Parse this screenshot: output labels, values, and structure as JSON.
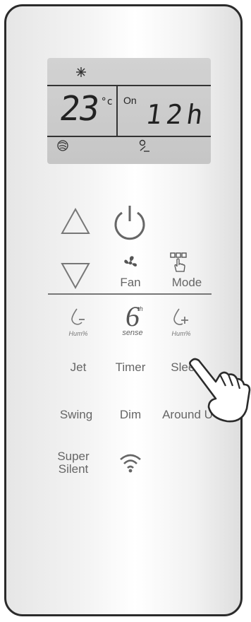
{
  "display": {
    "temperature": "23",
    "unit": "°c",
    "on_label": "On",
    "timer_value": "12h"
  },
  "buttons": {
    "fan": "Fan",
    "mode": "Mode",
    "hum_minus_sub": "Hum%",
    "sense_sub": "sense",
    "sense_sup": "th",
    "hum_plus_sub": "Hum%",
    "jet": "Jet",
    "timer": "Timer",
    "sleep": "Sleep",
    "swing": "Swing",
    "dim": "Dim",
    "around_u": "Around U",
    "super_silent_line1": "Super",
    "super_silent_line2": "Silent"
  },
  "icons": [
    "snowflake-icon",
    "fan-speed-icon",
    "person-icon",
    "up-arrow-icon",
    "power-icon",
    "down-arrow-icon",
    "fan-icon",
    "mode-icon",
    "hum-minus-icon",
    "sense-icon",
    "hum-plus-icon",
    "wifi-icon",
    "hand-pointer-icon"
  ]
}
